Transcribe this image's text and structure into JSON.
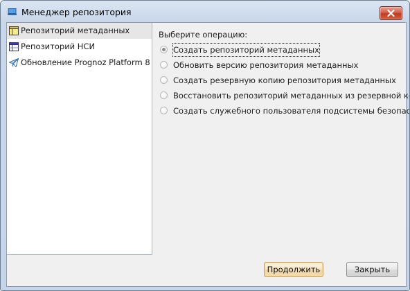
{
  "window": {
    "title": "Менеджер репозитория",
    "close_label": "✕"
  },
  "nav": {
    "items": [
      {
        "label": "Репозиторий метаданных",
        "icon": "metadata-repository-icon",
        "selected": true
      },
      {
        "label": "Репозиторий НСИ",
        "icon": "nsi-repository-icon",
        "selected": false
      },
      {
        "label": "Обновление Prognoz Platform 8",
        "icon": "paper-plane-icon",
        "selected": false
      }
    ]
  },
  "main": {
    "operation_label": "Выберите операцию:",
    "options": [
      {
        "label": "Создать репозиторий метаданных",
        "checked": true
      },
      {
        "label": "Обновить версию репозитория метаданных",
        "checked": false
      },
      {
        "label": "Создать резервную копию репозитория метаданных",
        "checked": false
      },
      {
        "label": "Восстановить репозиторий метаданных из резервной копии",
        "checked": false
      },
      {
        "label": "Создать служебного пользователя подсистемы безопасности",
        "checked": false
      }
    ]
  },
  "footer": {
    "continue_label": "Продолжить",
    "close_label": "Закрыть"
  },
  "colors": {
    "title_bar": "#c9d7ea",
    "close_button": "#c23a20",
    "selected_nav": "#e6e6e6",
    "default_button_border": "#c9a35d"
  }
}
